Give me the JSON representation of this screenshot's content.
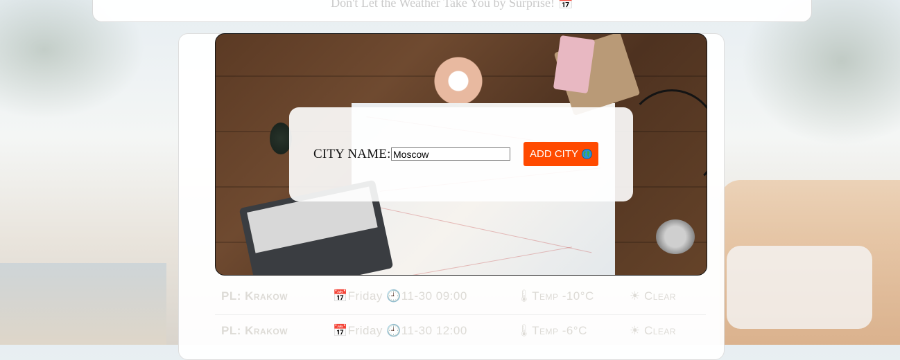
{
  "header": {
    "tagline": "Don't Let the Weather Take You by Surprise! 📅"
  },
  "form": {
    "city_label": "CITY NAME:",
    "city_value": "Moscow",
    "add_button_label": "ADD CITY",
    "button_icon": "globe-icon"
  },
  "weather_rows": [
    {
      "city": "PL: Krakow",
      "day": "📅Friday",
      "time": "🕘11-30 09:00",
      "temp": "🌡Temp -10°C",
      "condition": "☀ Clear"
    },
    {
      "city": "PL: Krakow",
      "day": "📅Friday",
      "time": "🕘11-30 12:00",
      "temp": "🌡Temp -6°C",
      "condition": "☀ Clear"
    }
  ],
  "colors": {
    "accent": "#ff4a00",
    "card_border": "#dedede"
  }
}
